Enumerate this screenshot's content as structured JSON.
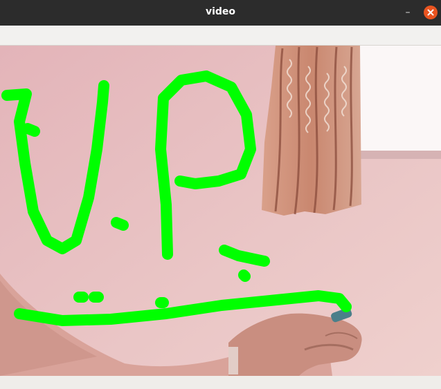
{
  "window": {
    "title": "video",
    "minimize_glyph": "–",
    "close_icon": "close-icon"
  },
  "video": {
    "scene": "webcam-feed",
    "overlay_color": "#00ff00",
    "wall_color": "#e6bfc1",
    "curtain_color": "#c98f7a",
    "window_light": "#ffffff"
  }
}
